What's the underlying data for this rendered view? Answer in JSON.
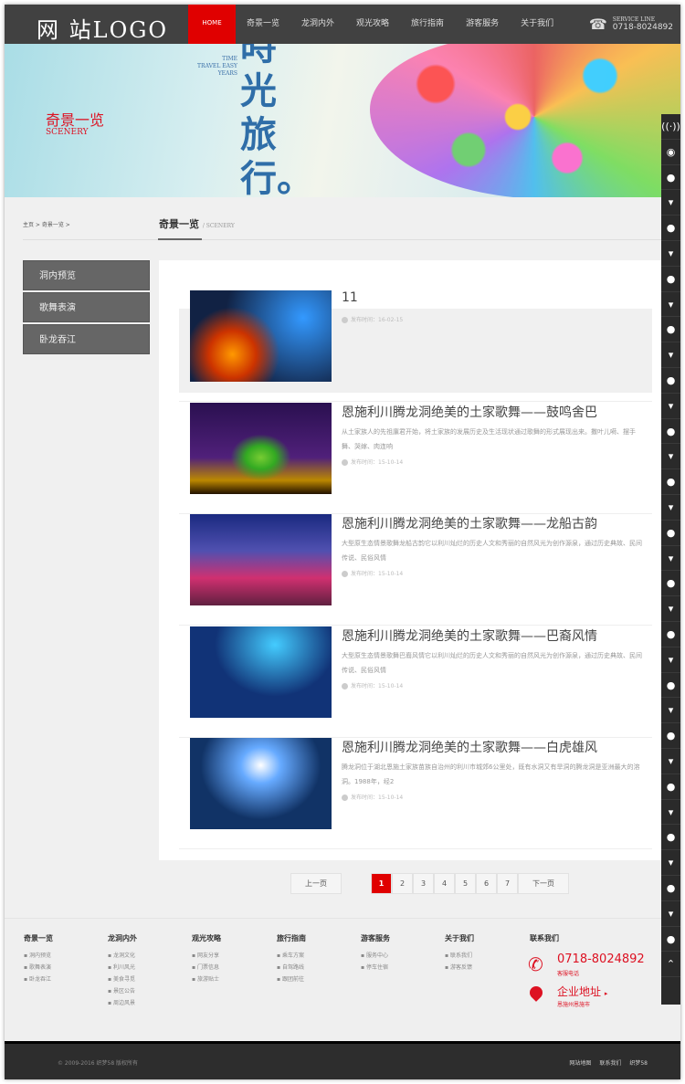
{
  "header": {
    "logo": "网 站LOGO",
    "nav": [
      "HOME",
      "奇景一览",
      "龙洞内外",
      "观光攻略",
      "旅行指南",
      "游客服务",
      "关于我们"
    ],
    "service_label": "SERVICE LINE",
    "phone": "0718-8024892"
  },
  "banner": {
    "title": "奇景一览",
    "subtitle": "SCENERY",
    "tagline": [
      "TIME",
      "TRAVEL EASY",
      "YEARS"
    ],
    "slogan": "時光旅行。"
  },
  "breadcrumb": "主页 > 奇景一览 >",
  "section": {
    "title": "奇景一览",
    "subtitle": "/ SCENERY"
  },
  "sidebar": [
    "洞内预览",
    "歌舞表演",
    "卧龙吞江"
  ],
  "items": [
    {
      "title": "11",
      "desc": "",
      "date": "发布时间：16-02-15"
    },
    {
      "title": "恩施利川腾龙洞绝美的土家歌舞——鼓鸣舍巴",
      "desc": "从土家族人的先祖廪君开始，将土家族的发展历史及生活现状通过歌舞的形式展现出来。撒叶儿嗬、摆手舞、哭嫁、肉连响",
      "date": "发布时间：15-10-14"
    },
    {
      "title": "恩施利川腾龙洞绝美的土家歌舞——龙船古韵",
      "desc": "大型原生态情景歌舞龙船古韵它以利川灿烂的历史人文和秀丽的自然风光为创作源泉，通过历史典故、民间传说、民俗风情",
      "date": "发布时间：15-10-14"
    },
    {
      "title": "恩施利川腾龙洞绝美的土家歌舞——巴裔风情",
      "desc": "大型原生态情景歌舞巴裔风情它以利川灿烂的历史人文和秀丽的自然风光为创作源泉，通过历史典故、民间传说、民俗风情",
      "date": "发布时间：15-10-14"
    },
    {
      "title": "恩施利川腾龙洞绝美的土家歌舞——白虎雄风",
      "desc": "腾龙洞位于湖北恩施土家族苗族自治州的利川市城郊6公里处，既有水洞又有旱洞的腾龙洞是亚洲最大的溶洞。1988年，经2",
      "date": "发布时间：15-10-14"
    }
  ],
  "pager": {
    "prev": "上一页",
    "pages": [
      "1",
      "2",
      "3",
      "4",
      "5",
      "6",
      "7"
    ],
    "next": "下一页",
    "current": "1"
  },
  "footer": {
    "cols": [
      {
        "title": "奇景一览",
        "links": [
          "洞内预览",
          "歌舞表演",
          "卧龙吞江"
        ]
      },
      {
        "title": "龙洞内外",
        "links": [
          "龙洞文化",
          "利川风光",
          "美食寻觅",
          "景区公告",
          "周边风景"
        ]
      },
      {
        "title": "观光攻略",
        "links": [
          "网友分享",
          "门票信息",
          "旅游贴士"
        ]
      },
      {
        "title": "旅行指南",
        "links": [
          "乘车方案",
          "自驾路线",
          "跟团前往"
        ]
      },
      {
        "title": "游客服务",
        "links": [
          "服务中心",
          "停车住宿"
        ]
      },
      {
        "title": "关于我们",
        "links": [
          "联系我们",
          "游客反馈"
        ]
      }
    ],
    "contact_title": "联系我们",
    "phone": "0718-8024892",
    "phone_label": "客服电话",
    "address_title": "企业地址",
    "address": "恩施州恩施市"
  },
  "bottom": {
    "copyright": "© 2009-2016 织梦58 版权所有",
    "links": [
      "网站地图",
      "联系我们",
      "织梦58"
    ]
  },
  "colors": {
    "accent": "#e00000"
  }
}
